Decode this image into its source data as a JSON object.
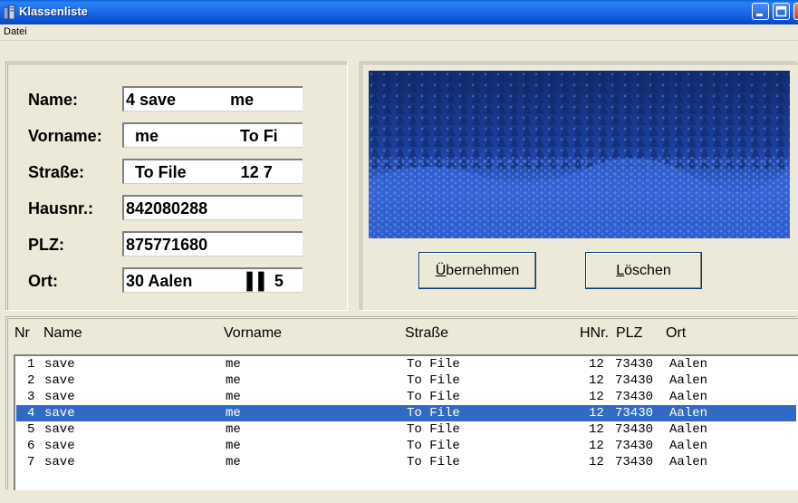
{
  "window": {
    "title": "Klassenliste"
  },
  "menu": [
    "Datei"
  ],
  "form": {
    "labels": {
      "name": "Name:",
      "vorname": "Vorname:",
      "strasse": "Straße:",
      "hausnr": "Hausnr.:",
      "plz": "PLZ:",
      "ort": "Ort:"
    },
    "values": {
      "name": "4 save            me",
      "vorname": "  me                  To Fi",
      "strasse": "  To File            12 7",
      "hausnr": "842080288",
      "plz": "875771680",
      "ort": "30 Aalen            ▌▌ 5"
    }
  },
  "buttons": {
    "uebernehmen": {
      "u": "Ü",
      "rest": "bernehmen"
    },
    "loeschen": {
      "u": "L",
      "rest": "öschen"
    }
  },
  "list": {
    "headers": {
      "nr": "Nr",
      "name": "Name",
      "vorname": "Vorname",
      "strasse": "Straße",
      "hnr": "HNr.",
      "plz": "PLZ",
      "ort": "Ort"
    },
    "rows": [
      {
        "nr": "1",
        "name": "save",
        "vorname": "me",
        "strasse": "To File",
        "hnr": "12",
        "plz": "73430",
        "ort": "Aalen"
      },
      {
        "nr": "2",
        "name": "save",
        "vorname": "me",
        "strasse": "To File",
        "hnr": "12",
        "plz": "73430",
        "ort": "Aalen"
      },
      {
        "nr": "3",
        "name": "save",
        "vorname": "me",
        "strasse": "To File",
        "hnr": "12",
        "plz": "73430",
        "ort": "Aalen"
      },
      {
        "nr": "4",
        "name": "save",
        "vorname": "me",
        "strasse": "To File",
        "hnr": "12",
        "plz": "73430",
        "ort": "Aalen"
      },
      {
        "nr": "5",
        "name": "save",
        "vorname": "me",
        "strasse": "To File",
        "hnr": "12",
        "plz": "73430",
        "ort": "Aalen"
      },
      {
        "nr": "6",
        "name": "save",
        "vorname": "me",
        "strasse": "To File",
        "hnr": "12",
        "plz": "73430",
        "ort": "Aalen"
      },
      {
        "nr": "7",
        "name": "save",
        "vorname": "me",
        "strasse": "To File",
        "hnr": "12",
        "plz": "73430",
        "ort": "Aalen"
      }
    ],
    "selected_nr": "4"
  },
  "colors": {
    "selection": "#316AC5",
    "titlebar": "#0A5FD8",
    "picture": "#1A3F9A"
  },
  "icons": {
    "app": "building-icon",
    "minimize": "minimize-icon",
    "maximize": "maximize-icon",
    "close": "close-icon"
  }
}
